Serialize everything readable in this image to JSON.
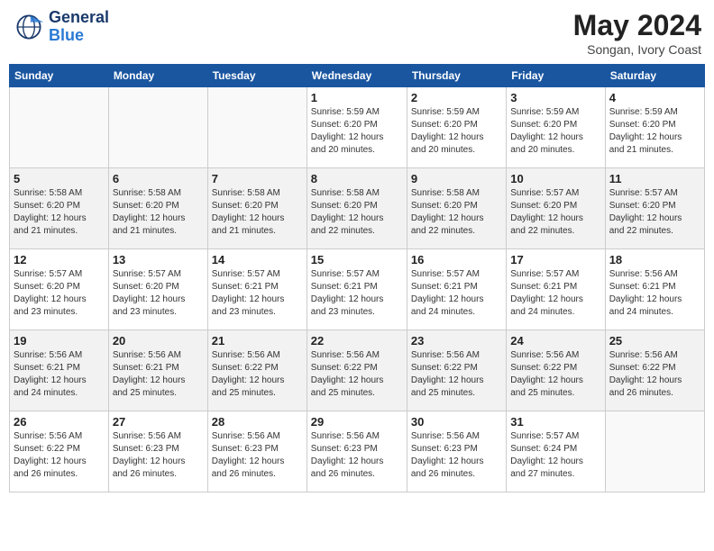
{
  "header": {
    "logo_line1": "General",
    "logo_line2": "Blue",
    "month_year": "May 2024",
    "location": "Songan, Ivory Coast"
  },
  "days_of_week": [
    "Sunday",
    "Monday",
    "Tuesday",
    "Wednesday",
    "Thursday",
    "Friday",
    "Saturday"
  ],
  "weeks": [
    [
      {
        "day": "",
        "info": ""
      },
      {
        "day": "",
        "info": ""
      },
      {
        "day": "",
        "info": ""
      },
      {
        "day": "1",
        "info": "Sunrise: 5:59 AM\nSunset: 6:20 PM\nDaylight: 12 hours\nand 20 minutes."
      },
      {
        "day": "2",
        "info": "Sunrise: 5:59 AM\nSunset: 6:20 PM\nDaylight: 12 hours\nand 20 minutes."
      },
      {
        "day": "3",
        "info": "Sunrise: 5:59 AM\nSunset: 6:20 PM\nDaylight: 12 hours\nand 20 minutes."
      },
      {
        "day": "4",
        "info": "Sunrise: 5:59 AM\nSunset: 6:20 PM\nDaylight: 12 hours\nand 21 minutes."
      }
    ],
    [
      {
        "day": "5",
        "info": "Sunrise: 5:58 AM\nSunset: 6:20 PM\nDaylight: 12 hours\nand 21 minutes."
      },
      {
        "day": "6",
        "info": "Sunrise: 5:58 AM\nSunset: 6:20 PM\nDaylight: 12 hours\nand 21 minutes."
      },
      {
        "day": "7",
        "info": "Sunrise: 5:58 AM\nSunset: 6:20 PM\nDaylight: 12 hours\nand 21 minutes."
      },
      {
        "day": "8",
        "info": "Sunrise: 5:58 AM\nSunset: 6:20 PM\nDaylight: 12 hours\nand 22 minutes."
      },
      {
        "day": "9",
        "info": "Sunrise: 5:58 AM\nSunset: 6:20 PM\nDaylight: 12 hours\nand 22 minutes."
      },
      {
        "day": "10",
        "info": "Sunrise: 5:57 AM\nSunset: 6:20 PM\nDaylight: 12 hours\nand 22 minutes."
      },
      {
        "day": "11",
        "info": "Sunrise: 5:57 AM\nSunset: 6:20 PM\nDaylight: 12 hours\nand 22 minutes."
      }
    ],
    [
      {
        "day": "12",
        "info": "Sunrise: 5:57 AM\nSunset: 6:20 PM\nDaylight: 12 hours\nand 23 minutes."
      },
      {
        "day": "13",
        "info": "Sunrise: 5:57 AM\nSunset: 6:20 PM\nDaylight: 12 hours\nand 23 minutes."
      },
      {
        "day": "14",
        "info": "Sunrise: 5:57 AM\nSunset: 6:21 PM\nDaylight: 12 hours\nand 23 minutes."
      },
      {
        "day": "15",
        "info": "Sunrise: 5:57 AM\nSunset: 6:21 PM\nDaylight: 12 hours\nand 23 minutes."
      },
      {
        "day": "16",
        "info": "Sunrise: 5:57 AM\nSunset: 6:21 PM\nDaylight: 12 hours\nand 24 minutes."
      },
      {
        "day": "17",
        "info": "Sunrise: 5:57 AM\nSunset: 6:21 PM\nDaylight: 12 hours\nand 24 minutes."
      },
      {
        "day": "18",
        "info": "Sunrise: 5:56 AM\nSunset: 6:21 PM\nDaylight: 12 hours\nand 24 minutes."
      }
    ],
    [
      {
        "day": "19",
        "info": "Sunrise: 5:56 AM\nSunset: 6:21 PM\nDaylight: 12 hours\nand 24 minutes."
      },
      {
        "day": "20",
        "info": "Sunrise: 5:56 AM\nSunset: 6:21 PM\nDaylight: 12 hours\nand 25 minutes."
      },
      {
        "day": "21",
        "info": "Sunrise: 5:56 AM\nSunset: 6:22 PM\nDaylight: 12 hours\nand 25 minutes."
      },
      {
        "day": "22",
        "info": "Sunrise: 5:56 AM\nSunset: 6:22 PM\nDaylight: 12 hours\nand 25 minutes."
      },
      {
        "day": "23",
        "info": "Sunrise: 5:56 AM\nSunset: 6:22 PM\nDaylight: 12 hours\nand 25 minutes."
      },
      {
        "day": "24",
        "info": "Sunrise: 5:56 AM\nSunset: 6:22 PM\nDaylight: 12 hours\nand 25 minutes."
      },
      {
        "day": "25",
        "info": "Sunrise: 5:56 AM\nSunset: 6:22 PM\nDaylight: 12 hours\nand 26 minutes."
      }
    ],
    [
      {
        "day": "26",
        "info": "Sunrise: 5:56 AM\nSunset: 6:22 PM\nDaylight: 12 hours\nand 26 minutes."
      },
      {
        "day": "27",
        "info": "Sunrise: 5:56 AM\nSunset: 6:23 PM\nDaylight: 12 hours\nand 26 minutes."
      },
      {
        "day": "28",
        "info": "Sunrise: 5:56 AM\nSunset: 6:23 PM\nDaylight: 12 hours\nand 26 minutes."
      },
      {
        "day": "29",
        "info": "Sunrise: 5:56 AM\nSunset: 6:23 PM\nDaylight: 12 hours\nand 26 minutes."
      },
      {
        "day": "30",
        "info": "Sunrise: 5:56 AM\nSunset: 6:23 PM\nDaylight: 12 hours\nand 26 minutes."
      },
      {
        "day": "31",
        "info": "Sunrise: 5:57 AM\nSunset: 6:24 PM\nDaylight: 12 hours\nand 27 minutes."
      },
      {
        "day": "",
        "info": ""
      }
    ]
  ]
}
